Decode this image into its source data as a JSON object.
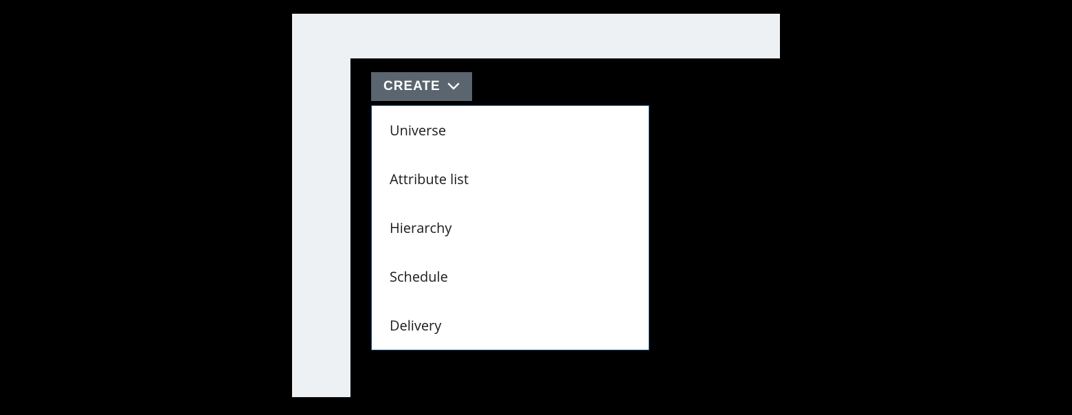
{
  "toolbar": {
    "create_button_label": "CREATE"
  },
  "create_menu": {
    "items": [
      {
        "label": "Universe"
      },
      {
        "label": "Attribute list"
      },
      {
        "label": "Hierarchy"
      },
      {
        "label": "Schedule"
      },
      {
        "label": "Delivery"
      }
    ]
  }
}
